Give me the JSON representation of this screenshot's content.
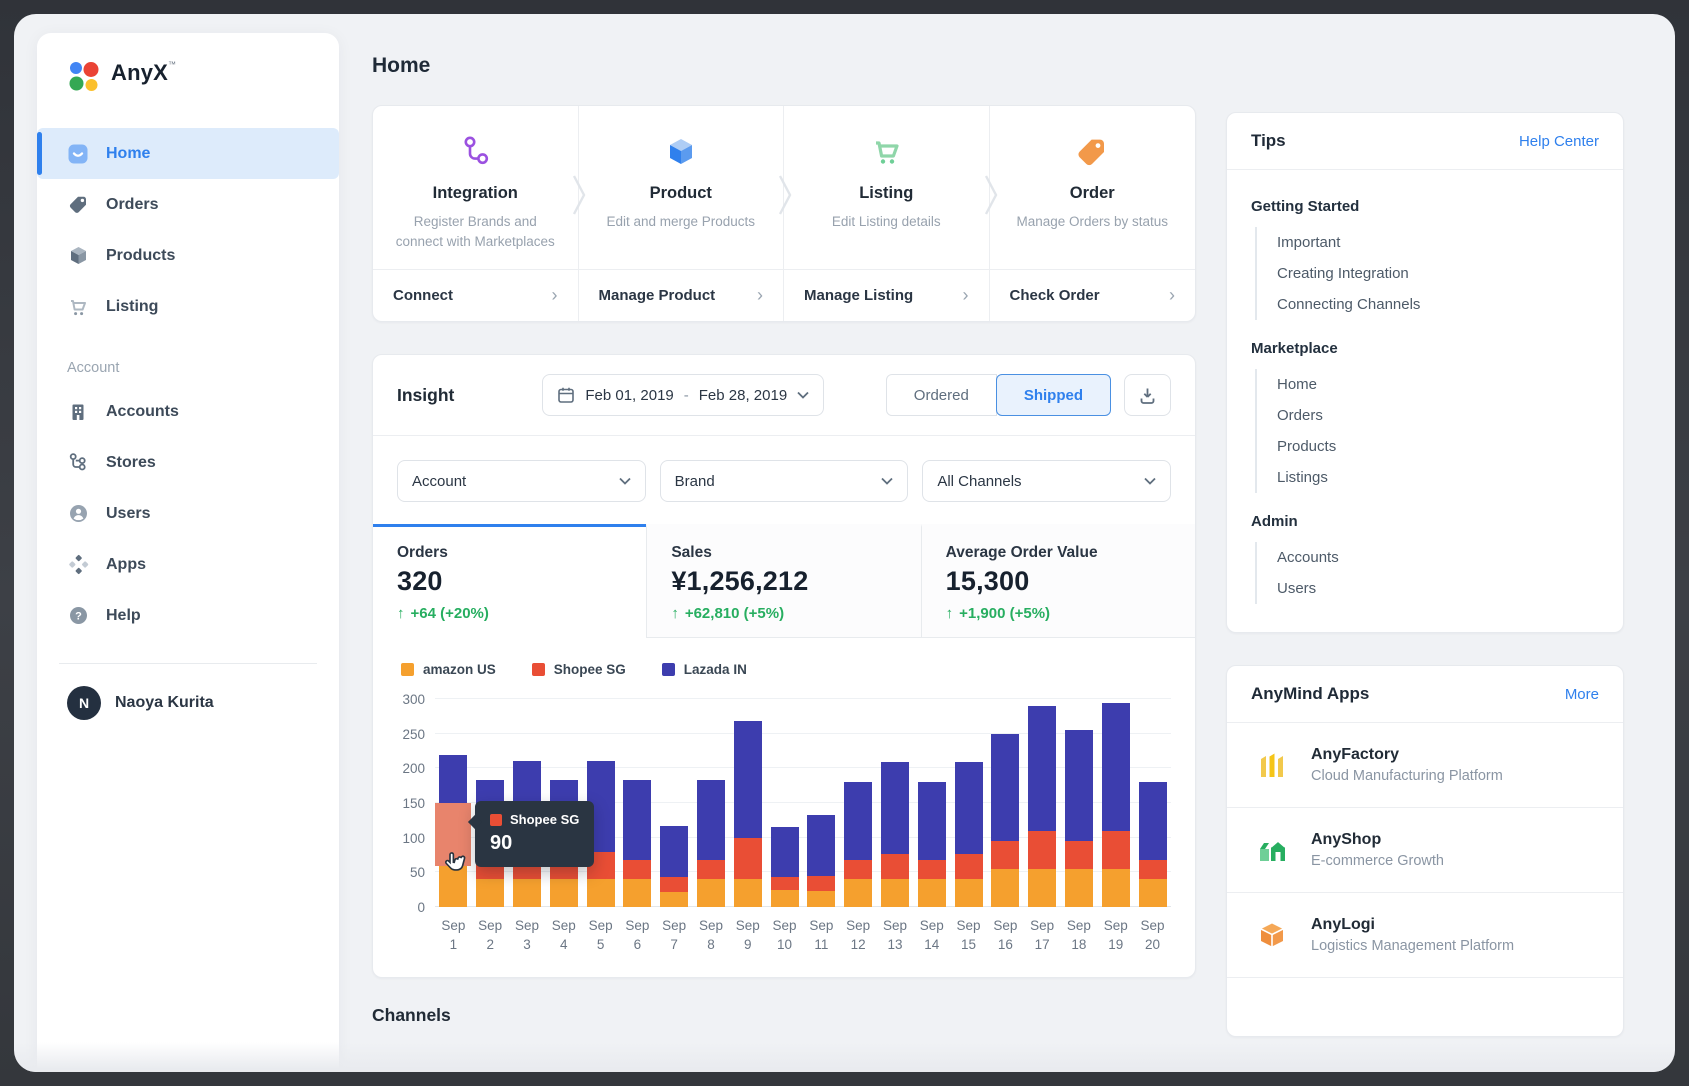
{
  "app": {
    "brand": "AnyX",
    "trademark": "™"
  },
  "page_title": "Home",
  "sidebar": {
    "nav": [
      {
        "label": "Home",
        "active": true
      },
      {
        "label": "Orders",
        "active": false
      },
      {
        "label": "Products",
        "active": false
      },
      {
        "label": "Listing",
        "active": false
      }
    ],
    "section_label": "Account",
    "account_nav": [
      {
        "label": "Accounts"
      },
      {
        "label": "Stores"
      },
      {
        "label": "Users"
      },
      {
        "label": "Apps"
      },
      {
        "label": "Help"
      }
    ],
    "user": {
      "initial": "N",
      "name": "Naoya Kurita"
    }
  },
  "workflow": {
    "steps": [
      {
        "title": "Integration",
        "description": "Register Brands and connect with Marketplaces",
        "action": "Connect"
      },
      {
        "title": "Product",
        "description": "Edit and merge Products",
        "action": "Manage Product"
      },
      {
        "title": "Listing",
        "description": "Edit Listing details",
        "action": "Manage Listing"
      },
      {
        "title": "Order",
        "description": "Manage Orders by status",
        "action": "Check Order"
      }
    ]
  },
  "insight": {
    "title": "Insight",
    "date_range": {
      "start": "Feb 01, 2019",
      "separator": "-",
      "end": "Feb 28, 2019"
    },
    "status_toggle": {
      "options": [
        "Ordered",
        "Shipped"
      ],
      "selected": "Shipped"
    },
    "filters": [
      {
        "label": "Account"
      },
      {
        "label": "Brand"
      },
      {
        "label": "All Channels"
      }
    ],
    "metrics": [
      {
        "label": "Orders",
        "value": "320",
        "delta_arrow": "↑",
        "delta": "+64 (+20%)",
        "active": true
      },
      {
        "label": "Sales",
        "value": "¥1,256,212",
        "delta_arrow": "↑",
        "delta": "+62,810 (+5%)",
        "active": false
      },
      {
        "label": "Average Order Value",
        "value": "15,300",
        "delta_arrow": "↑",
        "delta": "+1,900 (+5%)",
        "active": false
      }
    ],
    "tooltip": {
      "series": "Shopee SG",
      "value": "90"
    }
  },
  "chart_data": {
    "type": "bar",
    "stacked": true,
    "categories": [
      "Sep 1",
      "Sep 2",
      "Sep 3",
      "Sep 4",
      "Sep 5",
      "Sep 6",
      "Sep 7",
      "Sep 8",
      "Sep 9",
      "Sep 10",
      "Sep 11",
      "Sep 12",
      "Sep 13",
      "Sep 14",
      "Sep 15",
      "Sep 16",
      "Sep 17",
      "Sep 18",
      "Sep 19",
      "Sep 20"
    ],
    "series": [
      {
        "name": "amazon US",
        "color": "#F5A02E",
        "values": [
          60,
          40,
          40,
          40,
          40,
          40,
          22,
          40,
          40,
          25,
          23,
          40,
          40,
          40,
          40,
          55,
          55,
          55,
          55,
          40
        ]
      },
      {
        "name": "Shopee SG",
        "color": "#E94E35",
        "values": [
          90,
          30,
          40,
          30,
          40,
          28,
          22,
          28,
          60,
          18,
          22,
          28,
          36,
          28,
          36,
          40,
          55,
          40,
          55,
          28
        ]
      },
      {
        "name": "Lazada IN",
        "color": "#3D3DAE",
        "values": [
          70,
          113,
          131,
          113,
          131,
          115,
          73,
          115,
          168,
          72,
          88,
          112,
          134,
          112,
          134,
          155,
          180,
          160,
          185,
          112
        ]
      }
    ],
    "title": "",
    "xlabel": "",
    "ylabel": "",
    "ylim": [
      0,
      300
    ],
    "ytick_step": 50,
    "grid": true,
    "legend_position": "top-left",
    "highlight": {
      "category": "Sep 1",
      "series": "Shopee SG",
      "value": 90,
      "hover_color": "#E8846C"
    }
  },
  "channels": {
    "title": "Channels"
  },
  "tips": {
    "title": "Tips",
    "link": "Help Center",
    "sections": [
      {
        "heading": "Getting Started",
        "items": [
          "Important",
          "Creating Integration",
          "Connecting Channels"
        ]
      },
      {
        "heading": "Marketplace",
        "items": [
          "Home",
          "Orders",
          "Products",
          "Listings"
        ]
      },
      {
        "heading": "Admin",
        "items": [
          "Accounts",
          "Users"
        ]
      }
    ]
  },
  "anymind": {
    "title": "AnyMind Apps",
    "link": "More",
    "apps": [
      {
        "name": "AnyFactory",
        "description": "Cloud Manufacturing Platform"
      },
      {
        "name": "AnyShop",
        "description": "E-commerce Growth"
      },
      {
        "name": "AnyLogi",
        "description": "Logistics Management Platform"
      }
    ]
  },
  "colors": {
    "accent_blue": "#2F80ED",
    "positive_green": "#27AE60",
    "tooltip_bg": "#2A3542",
    "active_nav_bg": "#DDEBFB"
  }
}
